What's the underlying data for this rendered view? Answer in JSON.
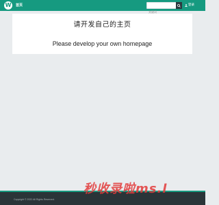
{
  "navbar": {
    "logo_letter": "W",
    "home_label": "首页",
    "search_placeholder": "关键词",
    "search_icon": "search-icon",
    "login_icon": "user-icon",
    "login_label": "登录",
    "color": "#169a80"
  },
  "main": {
    "title": "请开发自己的主页",
    "subtitle": "Please develop your own homepage"
  },
  "footer": {
    "copyright": "Copyright © 2022 All Rights Reserved.",
    "color": "#2a3438"
  },
  "watermark": {
    "text": "秒收录啦ms.l"
  }
}
